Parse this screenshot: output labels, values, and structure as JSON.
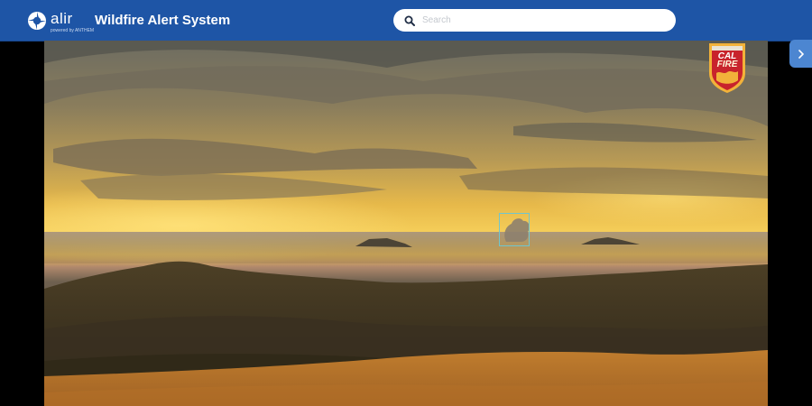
{
  "header": {
    "brand_name": "alir",
    "brand_sub": "powered by ANTHEM",
    "app_title": "Wildfire Alert System",
    "colors": {
      "bar": "#1e55a6",
      "text": "#ffffff"
    }
  },
  "search": {
    "placeholder": "Search",
    "value": "",
    "icon": "search-icon"
  },
  "camera": {
    "scene": "sunset view over hills with a smoke plume on the horizon",
    "detection": {
      "label": "smoke-detection",
      "color": "#6fc6cf"
    }
  },
  "badge": {
    "line1": "CAL",
    "line2": "FIRE",
    "colors": {
      "shield": "#c8232c",
      "trim": "#f2b23a"
    }
  },
  "side_toggle": {
    "icon": "chevron-right-icon",
    "color": "#4c86d1"
  }
}
